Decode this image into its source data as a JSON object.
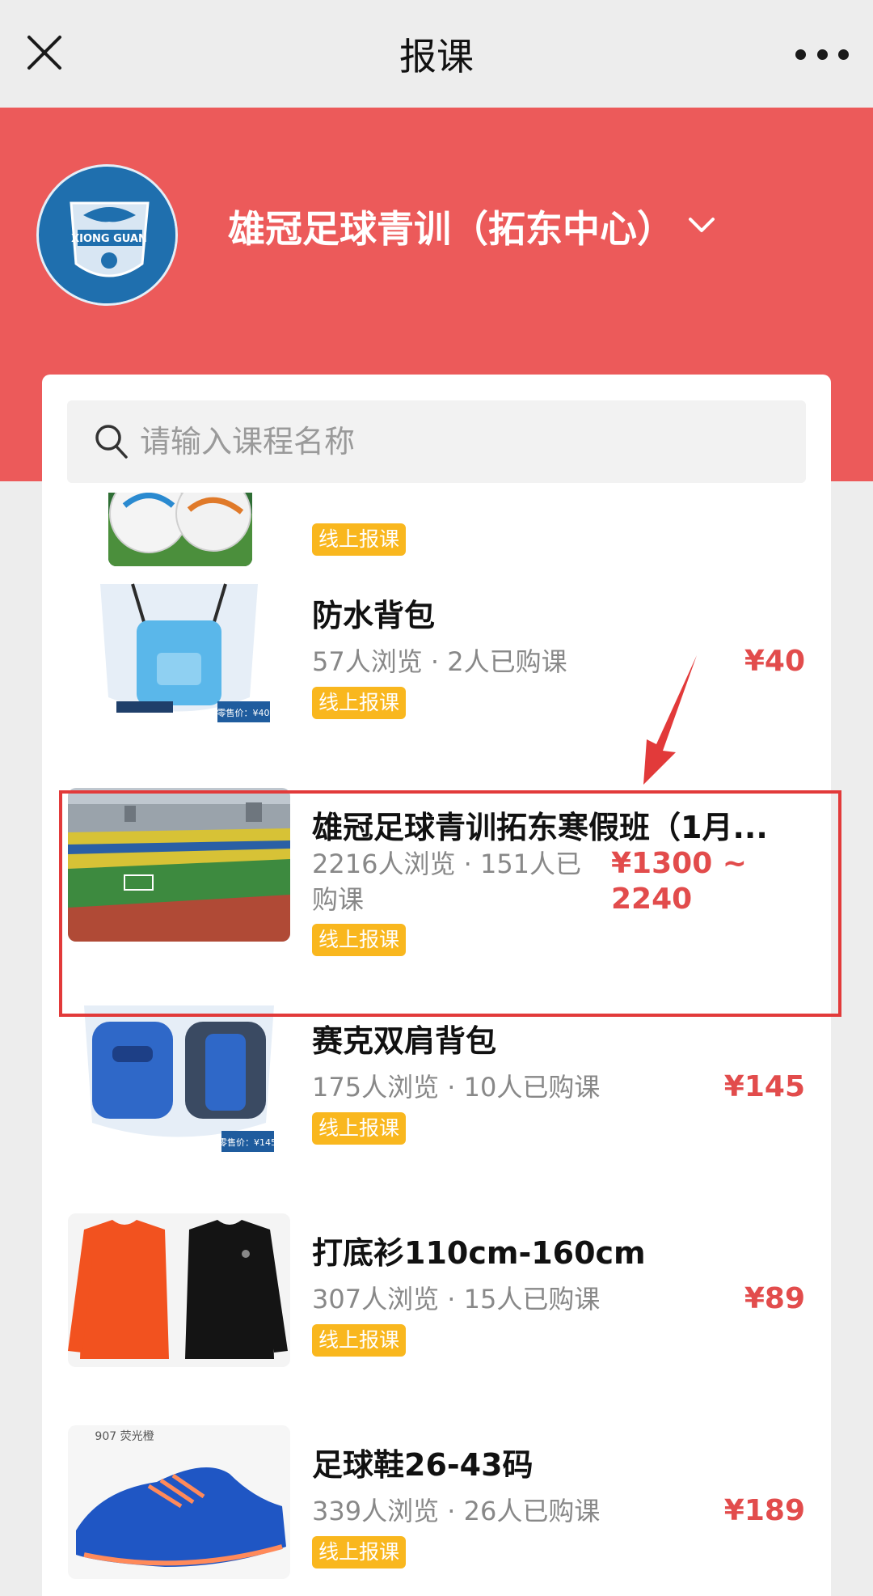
{
  "nav": {
    "title": "报课",
    "close_icon": "close-icon",
    "more_icon": "more-icon"
  },
  "header": {
    "org_name": "雄冠足球青训（拓东中心）",
    "logo_text": "XIONG GUAN",
    "background": "#ec5a5a"
  },
  "search": {
    "placeholder": "请输入课程名称"
  },
  "courses": [
    {
      "title": "",
      "meta": "",
      "price": "",
      "tag": "线上报课"
    },
    {
      "title": "防水背包",
      "meta": "57人浏览 · 2人已购课",
      "price": "¥40",
      "tag": "线上报课",
      "thumb_caption": "零售价：¥40"
    },
    {
      "title": "雄冠足球青训拓东寒假班（1月...",
      "meta": "2216人浏览 · 151人已购课",
      "price": "¥1300 ~ 2240",
      "tag": "线上报课"
    },
    {
      "title": "赛克双肩背包",
      "meta": "175人浏览 · 10人已购课",
      "price": "¥145",
      "tag": "线上报课",
      "thumb_caption": "零售价：¥145"
    },
    {
      "title": "打底衫110cm-160cm",
      "meta": "307人浏览 · 15人已购课",
      "price": "¥89",
      "tag": "线上报课"
    },
    {
      "title": "足球鞋26-43码",
      "meta": "339人浏览 · 26人已购课",
      "price": "¥189",
      "tag": "线上报课",
      "thumb_caption": "907 荧光橙"
    }
  ],
  "colors": {
    "accent_red": "#e24c4c",
    "tag_yellow": "#f9b71e",
    "highlight_border": "#e23a3a"
  }
}
